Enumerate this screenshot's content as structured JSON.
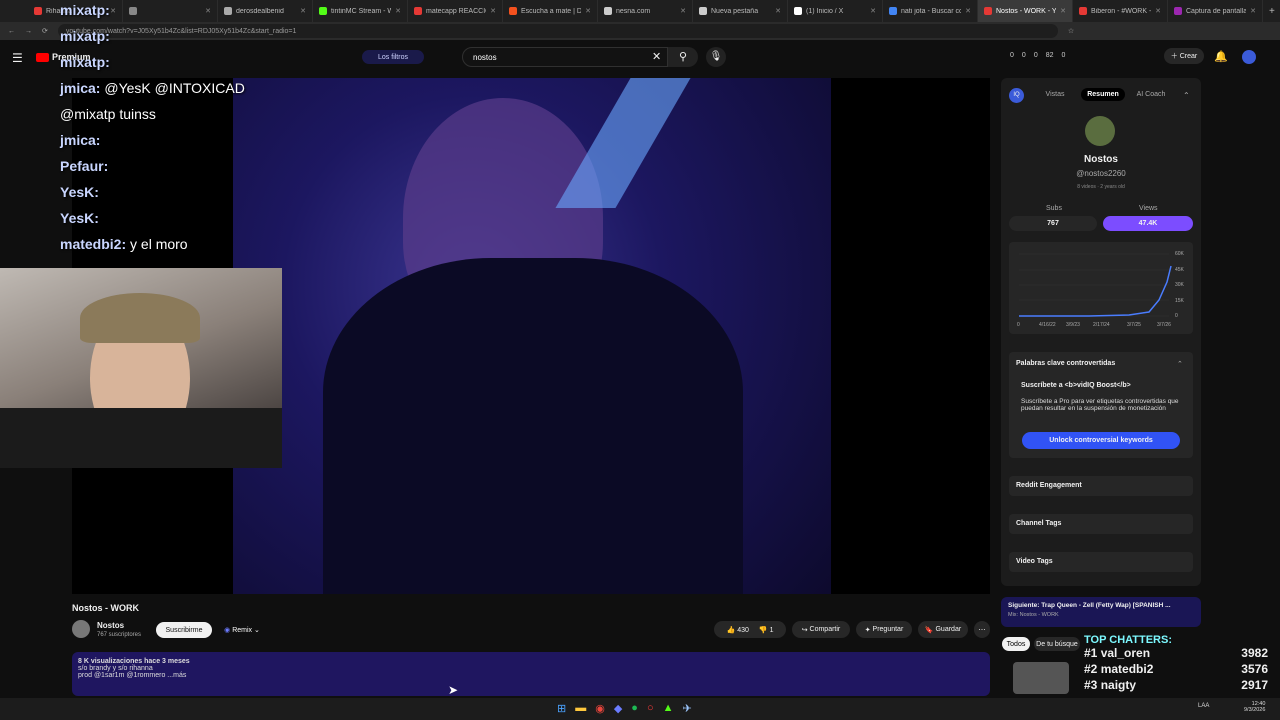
{
  "tabs": [
    {
      "title": "Rihanna",
      "color": "#e53935"
    },
    {
      "title": "",
      "color": "#888"
    },
    {
      "title": "derosdealbenid",
      "color": "#aaa"
    },
    {
      "title": "tintinMC Stream - Watc",
      "color": "#53fc18"
    },
    {
      "title": "matecapp REACCIONA",
      "color": "#e53935"
    },
    {
      "title": "Escucha a mate | Dish",
      "color": "#f4511e"
    },
    {
      "title": "nesna.com",
      "color": "#ccc"
    },
    {
      "title": "Nueva pestaña",
      "color": "#ccc"
    },
    {
      "title": "(1) Inicio / X",
      "color": "#fff"
    },
    {
      "title": "nati jota - Buscar con G",
      "color": "#4285f4"
    },
    {
      "title": "Nostos - WORK - Y",
      "color": "#e53935"
    },
    {
      "title": "Biberon - #WORK - Yo",
      "color": "#e53935"
    },
    {
      "title": "Captura de pantalla p",
      "color": "#9c27b0"
    }
  ],
  "address": "youtube.com/watch?v=J05Xy51b4Zc&list=RDJ05Xy51b4Zc&start_radio=1",
  "yt": {
    "logo": "Premium",
    "filters": "Los filtros",
    "query": "nostos",
    "create": "Crear",
    "stats": [
      "0",
      "0",
      "0",
      "82",
      "0"
    ]
  },
  "chat": [
    {
      "name": "mixatp:",
      "msg": ""
    },
    {
      "name": "mixatp:",
      "msg": ""
    },
    {
      "name": "mixatp:",
      "msg": ""
    },
    {
      "name": "jmica:",
      "msg": "@YesK @INTOXICAD"
    },
    {
      "name": "",
      "msg": "@mixatp tuinss"
    },
    {
      "name": "jmica:",
      "msg": ""
    },
    {
      "name": "Pefaur:",
      "msg": ""
    },
    {
      "name": "YesK:",
      "msg": ""
    },
    {
      "name": "YesK:",
      "msg": ""
    },
    {
      "name": "matedbi2:",
      "msg": "y el moro"
    }
  ],
  "video": {
    "title": "Nostos - WORK",
    "channel": "Nostos",
    "subs": "767 suscriptores",
    "subscribe": "Suscribirme",
    "remix": "Remix",
    "likes": "430",
    "dislikes": "1",
    "share": "Compartir",
    "ask": "Preguntar",
    "save": "Guardar",
    "views": "8 K visualizaciones  hace 3 meses",
    "desc1": "s/o brandy y s/o rihanna",
    "desc2": "prod @1sar1m @1rommero ...más"
  },
  "sidebar": {
    "tabs": [
      "Vistas",
      "Resumen",
      "AI Coach"
    ],
    "channel": "Nostos",
    "handle": "@nostos2260",
    "meta": "8 videos  ·  2 years old",
    "subs_label": "Subs",
    "views_label": "Views",
    "subs": "767",
    "views": "47.4K",
    "y_ticks": [
      "60K",
      "45K",
      "30K",
      "15K",
      "0"
    ],
    "x_ticks": [
      "0",
      "4/16/22",
      "3/9/23",
      "2/17/24",
      "3/7/25",
      "3/7/26"
    ],
    "kw_title": "Palabras clave controvertidas",
    "boost": "Suscríbete a <b>vidIQ Boost</b>",
    "boost_desc": "Suscríbete a Pro para ver etiquetas controvertidas que puedan resultar en la suspensión de monetización",
    "unlock": "Unlock controversial keywords",
    "reddit": "Reddit Engagement",
    "ctags": "Channel Tags",
    "vtags": "Video Tags",
    "next": "Siguiente: Trap Queen - Zell (Fetty Wap) [SPANISH ...",
    "mix": "Mix: Nostos - WORK",
    "chip_all": "Todos",
    "chip_search": "De tu búsque"
  },
  "top": {
    "title": "TOP CHATTERS:",
    "rows": [
      {
        "rank": "#1",
        "name": "val_oren",
        "count": "3982"
      },
      {
        "rank": "#2",
        "name": "matedbi2",
        "count": "3576"
      },
      {
        "rank": "#3",
        "name": "naigty",
        "count": "2917"
      }
    ]
  },
  "clock": {
    "time": "12:40",
    "date": "9/3/2026",
    "lang": "LAA"
  }
}
